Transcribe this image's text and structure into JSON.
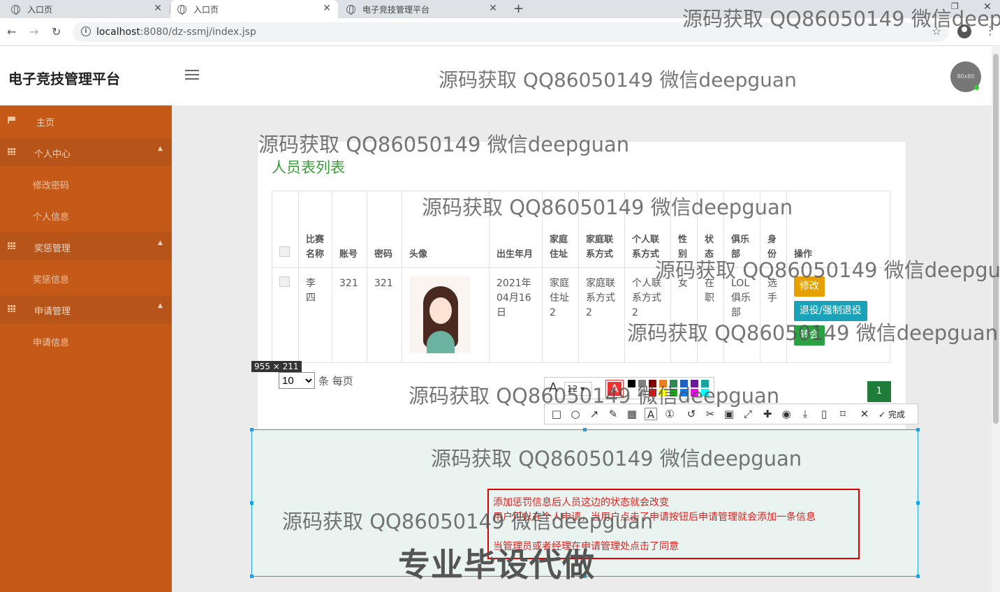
{
  "browser": {
    "tabs": [
      {
        "label": "入口页"
      },
      {
        "label": "入口页"
      },
      {
        "label": "电子竞技管理平台"
      }
    ],
    "url_host": "localhost",
    "url_path": ":8080/dz-ssmj/index.jsp"
  },
  "app": {
    "brand": "电子竞技管理平台",
    "avatar_text": "80x80",
    "header_watermark": "源码获取 QQ86050149 微信deepguan"
  },
  "sidebar": {
    "items": [
      {
        "label": "主页",
        "icon": "flag-icon"
      },
      {
        "label": "个人中心",
        "icon": "grid-icon"
      },
      {
        "label": "修改密码"
      },
      {
        "label": "个人信息"
      },
      {
        "label": "奖惩管理",
        "icon": "grid-icon"
      },
      {
        "label": "奖惩信息"
      },
      {
        "label": "申请管理",
        "icon": "grid-icon"
      },
      {
        "label": "申请信息"
      }
    ]
  },
  "card": {
    "title": "人员表列表",
    "columns": [
      "比赛名称",
      "账号",
      "密码",
      "头像",
      "出生年月",
      "家庭住址",
      "家庭联系方式",
      "个人联系方式",
      "性别",
      "状态",
      "俱乐部",
      "身份",
      "操作"
    ],
    "row": {
      "name": "李四",
      "account": "321",
      "password": "321",
      "birth": "2021年04月16日",
      "address": "家庭住址2",
      "family_contact": "家庭联系方式2",
      "personal_contact": "个人联系方式2",
      "gender": "女",
      "status": "在职",
      "club": "LOL俱乐部",
      "role": "选手"
    },
    "buttons": {
      "edit": "修改",
      "quit": "退役/强制退役",
      "transfer": "转会"
    },
    "pager": {
      "page_size": "10",
      "suffix": "条 每页",
      "page": "1"
    }
  },
  "screenshot_tool": {
    "size_label": "955 × 211",
    "font_size": "12",
    "current_color": "#e33333",
    "done_label": "完成",
    "swatches": [
      "#000000",
      "#808080",
      "#800000",
      "#e67e22",
      "#2e8b57",
      "#2060c0",
      "#6a1b9a",
      "#1aa3a3",
      "#ffffff",
      "#c0c0c0",
      "#ff0000",
      "#ffff00",
      "#00c000",
      "#0080ff",
      "#ff00ff",
      "#00ffff"
    ]
  },
  "annotation": {
    "line1": "添加惩罚信息后人员这边的状态就会改变",
    "line2": "用户可以在个人申请，当用户点击了申请按钮后申请管理就会添加一条信息",
    "line3": "当管理员或者经理在申请管理处点击了同意",
    "big_text": "专业毕设代做"
  },
  "watermark": "源码获取 QQ86050149 微信deepguan"
}
